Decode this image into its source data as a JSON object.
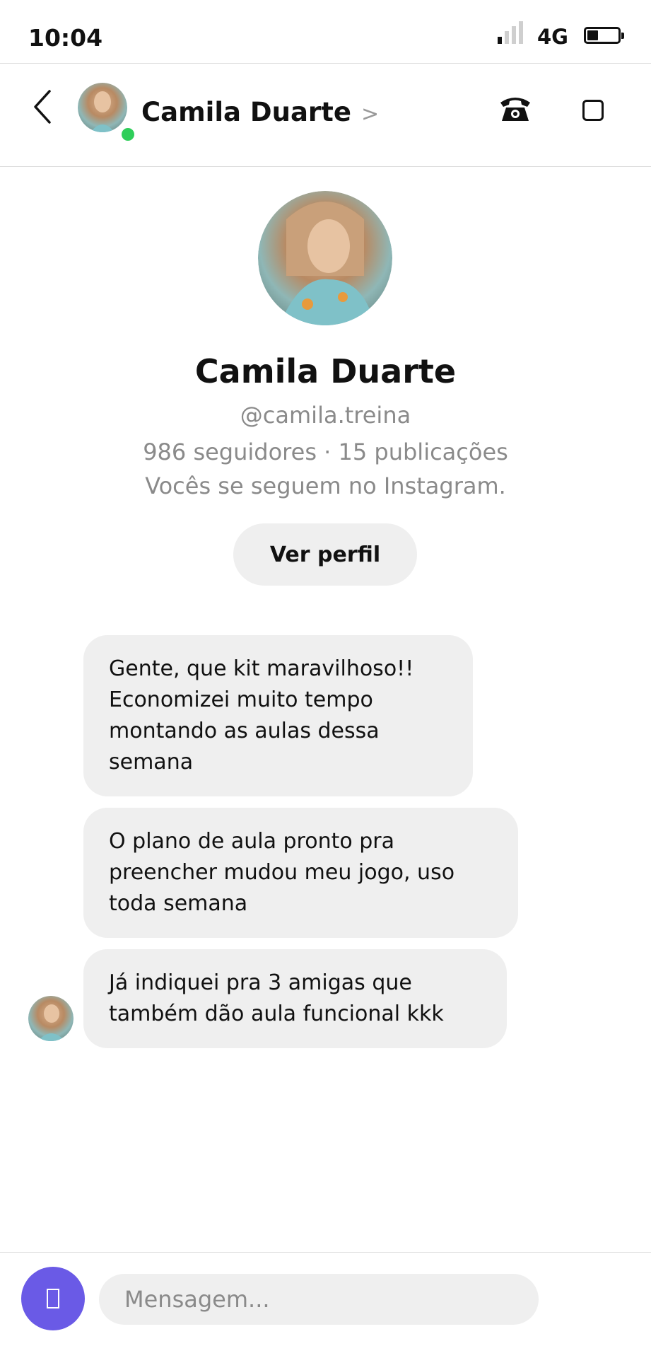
{
  "status_bar": {
    "time": "10:04",
    "network": "4G",
    "signal_bars_active": 1,
    "signal_bars_total": 4,
    "battery_level_percent": 35
  },
  "header": {
    "contact_name": "Camila Duarte",
    "chevron": ">",
    "online": true,
    "online_color": "#2fce5a",
    "icons": [
      "back-icon",
      "phone-icon",
      "video-icon"
    ]
  },
  "profile": {
    "name": "Camila Duarte",
    "handle": "@camila.treina",
    "stats": "986 seguidores · 15 publicações",
    "mutual": "Vocês se seguem no Instagram.",
    "view_profile_label": "Ver perfil"
  },
  "messages": [
    {
      "text": "Gente, que kit maravilhoso!!\nEconomizei muito tempo\nmontando as aulas dessa\nsemana"
    },
    {
      "text": "O plano de aula pronto pra\npreencher mudou meu jogo, uso\ntoda semana"
    },
    {
      "text": "Já indiquei pra 3 amigas que\ntambém dão aula funcional kkk"
    }
  ],
  "composer": {
    "placeholder": "Mensagem...",
    "value": "",
    "camera_color": "#6a5ae6"
  },
  "colors": {
    "bubble_bg": "#efefef",
    "secondary_text": "#8a8a8a",
    "divider": "#dcdcdc"
  }
}
